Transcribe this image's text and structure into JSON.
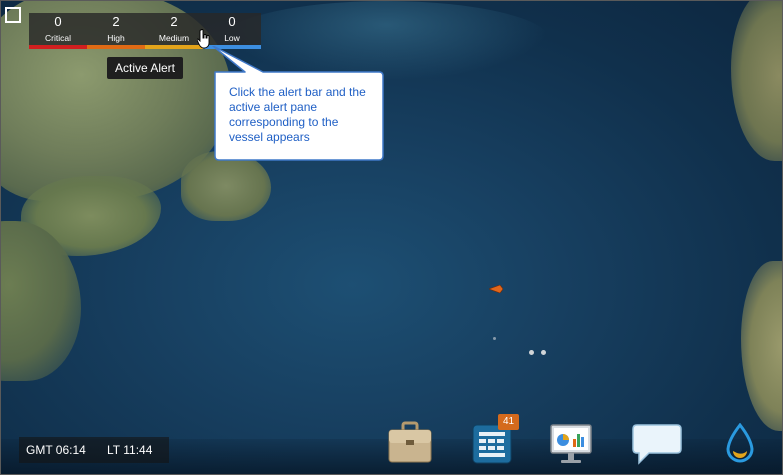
{
  "alerts": [
    {
      "count": "0",
      "label": "Critical",
      "color": "#d11f1f"
    },
    {
      "count": "2",
      "label": "High",
      "color": "#e06a14"
    },
    {
      "count": "2",
      "label": "Medium",
      "color": "#e3a41a"
    },
    {
      "count": "0",
      "label": "Low",
      "color": "#3c8ee0"
    }
  ],
  "tooltip": {
    "text": "Active Alert"
  },
  "callout": {
    "text": "Click the alert bar and the active alert pane corresponding to the vessel appears"
  },
  "clock": {
    "gmt": "GMT 06:14",
    "lt": "LT 11:44"
  },
  "dock": {
    "icons": [
      "briefcase-icon",
      "schedule-icon",
      "dashboard-monitor-icon",
      "chat-icon",
      "water-drop-icon"
    ],
    "schedule_badge": "41"
  },
  "colors": {
    "vessel": "#e0661c",
    "callout_border": "#3f78c8",
    "callout_text": "#1f5fc5"
  }
}
